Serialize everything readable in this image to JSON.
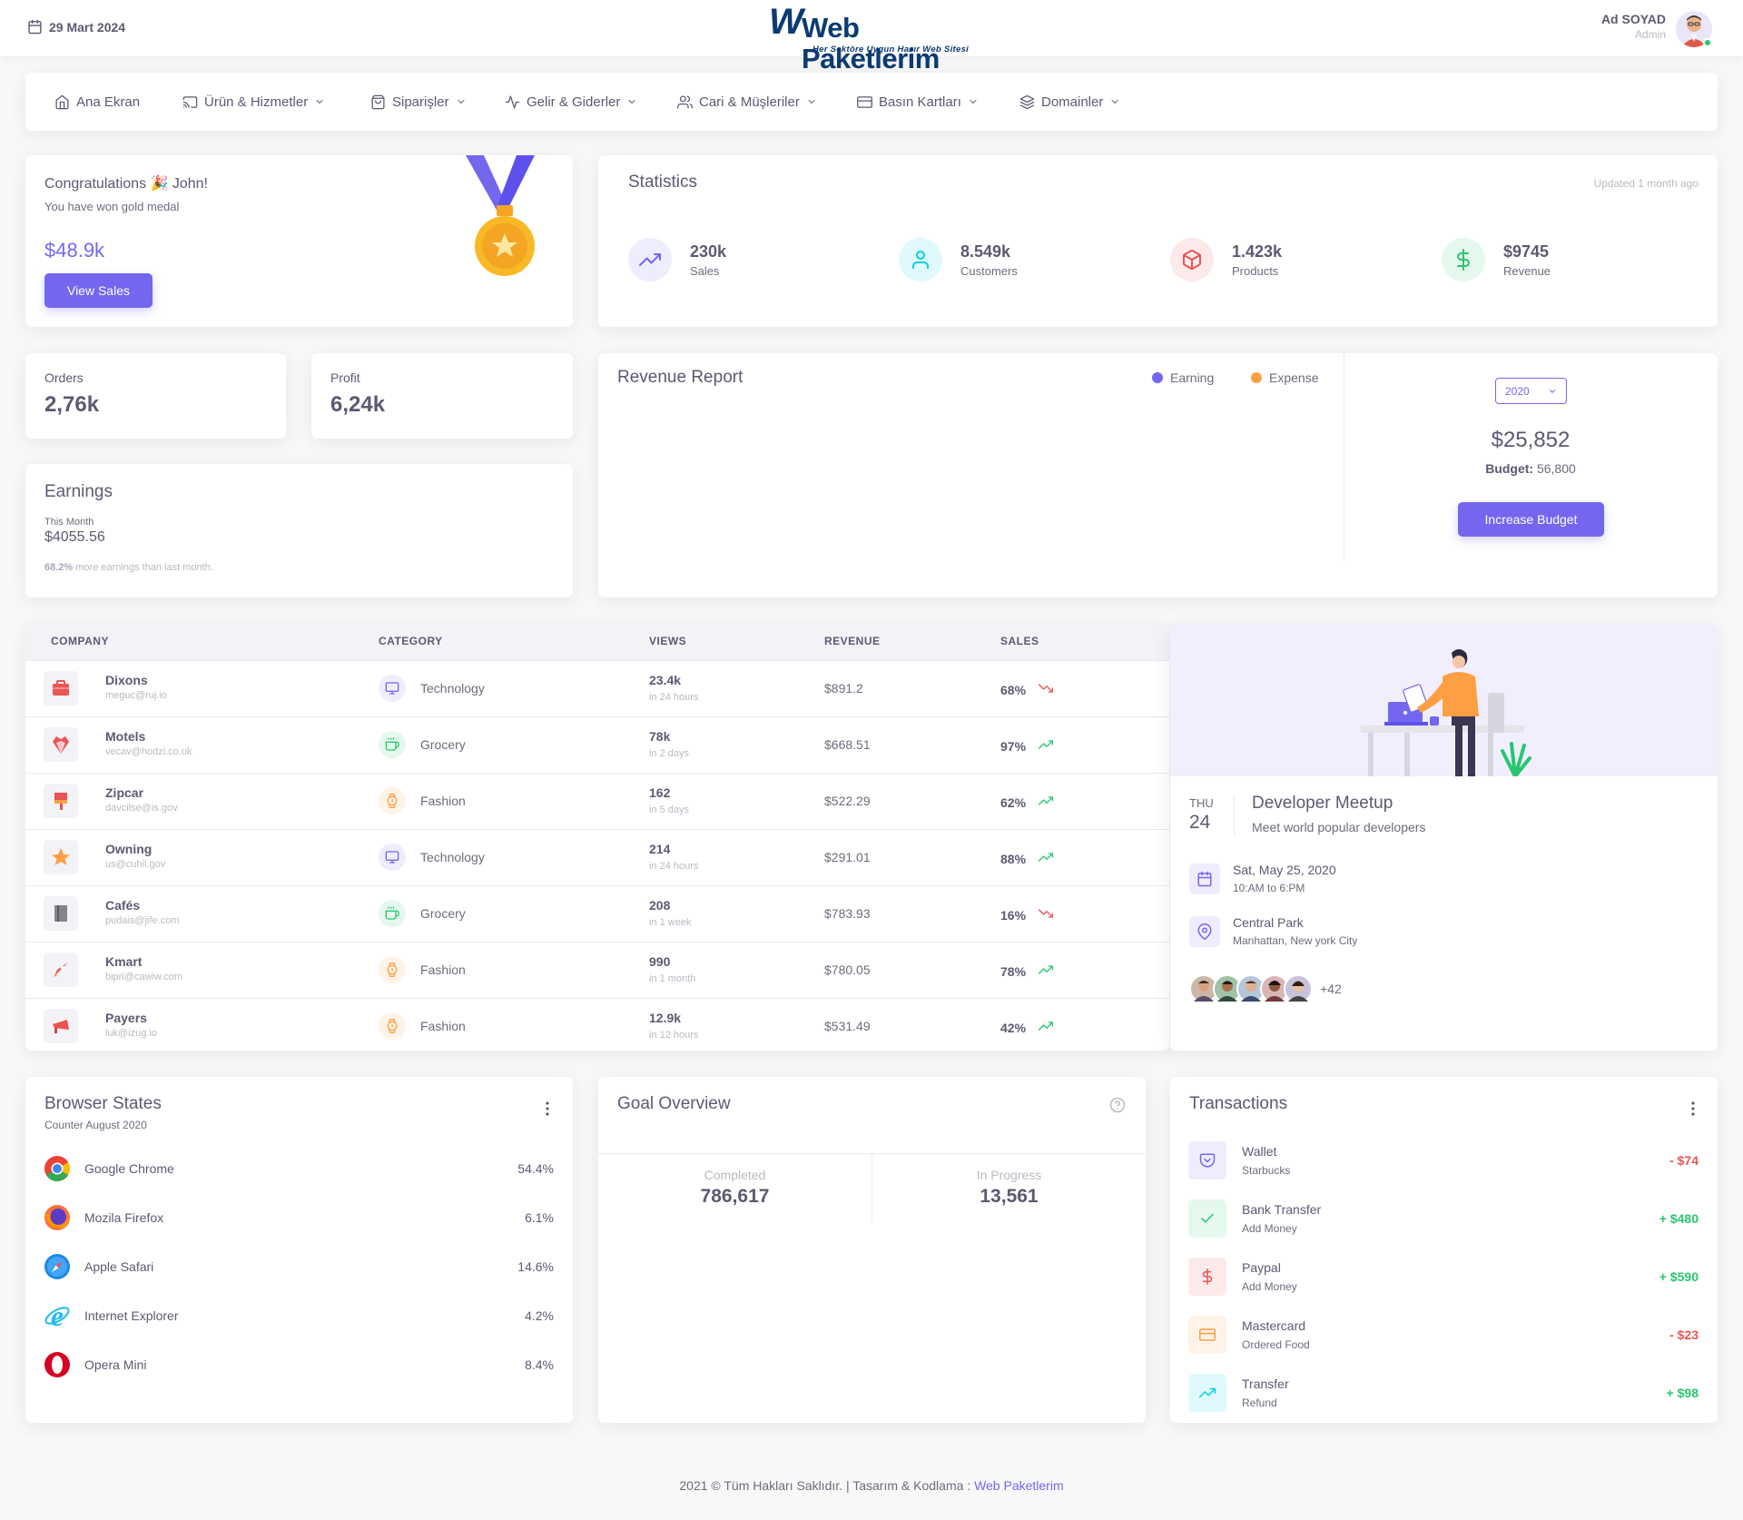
{
  "header": {
    "date": "29 Mart 2024",
    "logo_text": "Web Paketlerim",
    "logo_tagline": "Her Sektöre Uygun Hazır Web Sitesi",
    "user_name": "Ad SOYAD",
    "user_role": "Admin"
  },
  "nav": [
    {
      "label": "Ana Ekran",
      "icon": "home-icon"
    },
    {
      "label": "Ürün & Hizmetler",
      "icon": "cast-icon"
    },
    {
      "label": "Siparişler",
      "icon": "shopping-bag-icon"
    },
    {
      "label": "Gelir & Giderler",
      "icon": "activity-icon"
    },
    {
      "label": "Cari & Müşleriler",
      "icon": "users-icon"
    },
    {
      "label": "Basın Kartları",
      "icon": "credit-card-icon"
    },
    {
      "label": "Domainler",
      "icon": "layers-icon"
    }
  ],
  "congrats": {
    "title": "Congratulations 🎉 John!",
    "subtitle": "You have won gold medal",
    "amount": "$48.9k",
    "button": "View Sales"
  },
  "statistics": {
    "title": "Statistics",
    "updated": "Updated 1 month ago",
    "items": [
      {
        "value": "230k",
        "label": "Sales",
        "icon": "trending-up-icon",
        "color": "#7367f0"
      },
      {
        "value": "8.549k",
        "label": "Customers",
        "icon": "user-icon",
        "color": "#00cfe8"
      },
      {
        "value": "1.423k",
        "label": "Products",
        "icon": "box-icon",
        "color": "#ea5455"
      },
      {
        "value": "$9745",
        "label": "Revenue",
        "icon": "dollar-sign-icon",
        "color": "#28c76f"
      }
    ]
  },
  "orders": {
    "label": "Orders",
    "value": "2,76k"
  },
  "profit": {
    "label": "Profit",
    "value": "6,24k"
  },
  "earnings": {
    "title": "Earnings",
    "period": "This Month",
    "value": "$4055.56",
    "note_pct": "68.2%",
    "note_text": " more earnings than last month."
  },
  "revenue": {
    "title": "Revenue Report",
    "legend_earning": "Earning",
    "legend_expense": "Expense",
    "year": "2020",
    "amount": "$25,852",
    "budget_label": "Budget:",
    "budget_value": "56,800",
    "button": "Increase Budget",
    "colors": {
      "earning": "#7367f0",
      "expense": "#ff9f43"
    }
  },
  "table": {
    "headers": [
      "COMPANY",
      "CATEGORY",
      "VIEWS",
      "REVENUE",
      "SALES"
    ],
    "rows": [
      {
        "name": "Dixons",
        "email": "meguc@ruj.io",
        "category": "Technology",
        "views": "23.4k",
        "period": "in 24 hours",
        "revenue": "$891.2",
        "sales": "68%",
        "trend": "down"
      },
      {
        "name": "Motels",
        "email": "vecav@hodzi.co.uk",
        "category": "Grocery",
        "views": "78k",
        "period": "in 2 days",
        "revenue": "$668.51",
        "sales": "97%",
        "trend": "up"
      },
      {
        "name": "Zipcar",
        "email": "davcilse@is.gov",
        "category": "Fashion",
        "views": "162",
        "period": "in 5 days",
        "revenue": "$522.29",
        "sales": "62%",
        "trend": "up"
      },
      {
        "name": "Owning",
        "email": "us@cuhil.gov",
        "category": "Technology",
        "views": "214",
        "period": "in 24 hours",
        "revenue": "$291.01",
        "sales": "88%",
        "trend": "up"
      },
      {
        "name": "Cafés",
        "email": "pudais@jife.com",
        "category": "Grocery",
        "views": "208",
        "period": "in 1 week",
        "revenue": "$783.93",
        "sales": "16%",
        "trend": "down"
      },
      {
        "name": "Kmart",
        "email": "bipri@cawiw.com",
        "category": "Fashion",
        "views": "990",
        "period": "in 1 month",
        "revenue": "$780.05",
        "sales": "78%",
        "trend": "up"
      },
      {
        "name": "Payers",
        "email": "luk@izug.io",
        "category": "Fashion",
        "views": "12.9k",
        "period": "in 12 hours",
        "revenue": "$531.49",
        "sales": "42%",
        "trend": "up"
      }
    ]
  },
  "meetup": {
    "day": "THU",
    "date": "24",
    "title": "Developer Meetup",
    "subtitle": "Meet world popular developers",
    "when": "Sat, May 25, 2020",
    "time": "10:AM to 6:PM",
    "where": "Central Park",
    "address": "Manhattan, New york City",
    "extra": "+42"
  },
  "browsers": {
    "title": "Browser States",
    "subtitle": "Counter August 2020",
    "items": [
      {
        "name": "Google Chrome",
        "pct": "54.4%"
      },
      {
        "name": "Mozila Firefox",
        "pct": "6.1%"
      },
      {
        "name": "Apple Safari",
        "pct": "14.6%"
      },
      {
        "name": "Internet Explorer",
        "pct": "4.2%"
      },
      {
        "name": "Opera Mini",
        "pct": "8.4%"
      }
    ]
  },
  "goal": {
    "title": "Goal Overview",
    "completed_label": "Completed",
    "completed_value": "786,617",
    "progress_label": "In Progress",
    "progress_value": "13,561"
  },
  "transactions": {
    "title": "Transactions",
    "items": [
      {
        "name": "Wallet",
        "sub": "Starbucks",
        "amount": "- $74",
        "icon": "pocket-icon",
        "color": "#7367f0"
      },
      {
        "name": "Bank Transfer",
        "sub": "Add Money",
        "amount": "+ $480",
        "icon": "check-icon",
        "color": "#28c76f"
      },
      {
        "name": "Paypal",
        "sub": "Add Money",
        "amount": "+ $590",
        "icon": "dollar-sign-icon",
        "color": "#ea5455"
      },
      {
        "name": "Mastercard",
        "sub": "Ordered Food",
        "amount": "- $23",
        "icon": "credit-card-icon",
        "color": "#ff9f43"
      },
      {
        "name": "Transfer",
        "sub": "Refund",
        "amount": "+ $98",
        "icon": "trending-up-icon",
        "color": "#00cfe8"
      }
    ]
  },
  "footer": {
    "text": "2021 © Tüm Hakları Saklıdır. | Tasarım & Kodlama : ",
    "link": "Web Paketlerim"
  }
}
